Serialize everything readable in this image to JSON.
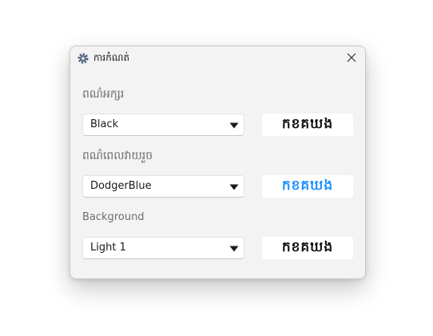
{
  "window": {
    "title": "ការកំណត់",
    "close_symbol": "✕"
  },
  "colors": {
    "text_color_value": "#111111",
    "highlight_color_value": "#1e90ff"
  },
  "settings": {
    "text_color": {
      "label": "ពណ៌អក្សរ",
      "selected": "Black",
      "preview": "កខគឃង"
    },
    "highlight_color": {
      "label": "ពណ៌ពេលវាយរួច",
      "selected": "DodgerBlue",
      "preview": "កខគឃង"
    },
    "background": {
      "label": "Background",
      "selected": "Light 1",
      "preview": "កខគឃង"
    }
  }
}
